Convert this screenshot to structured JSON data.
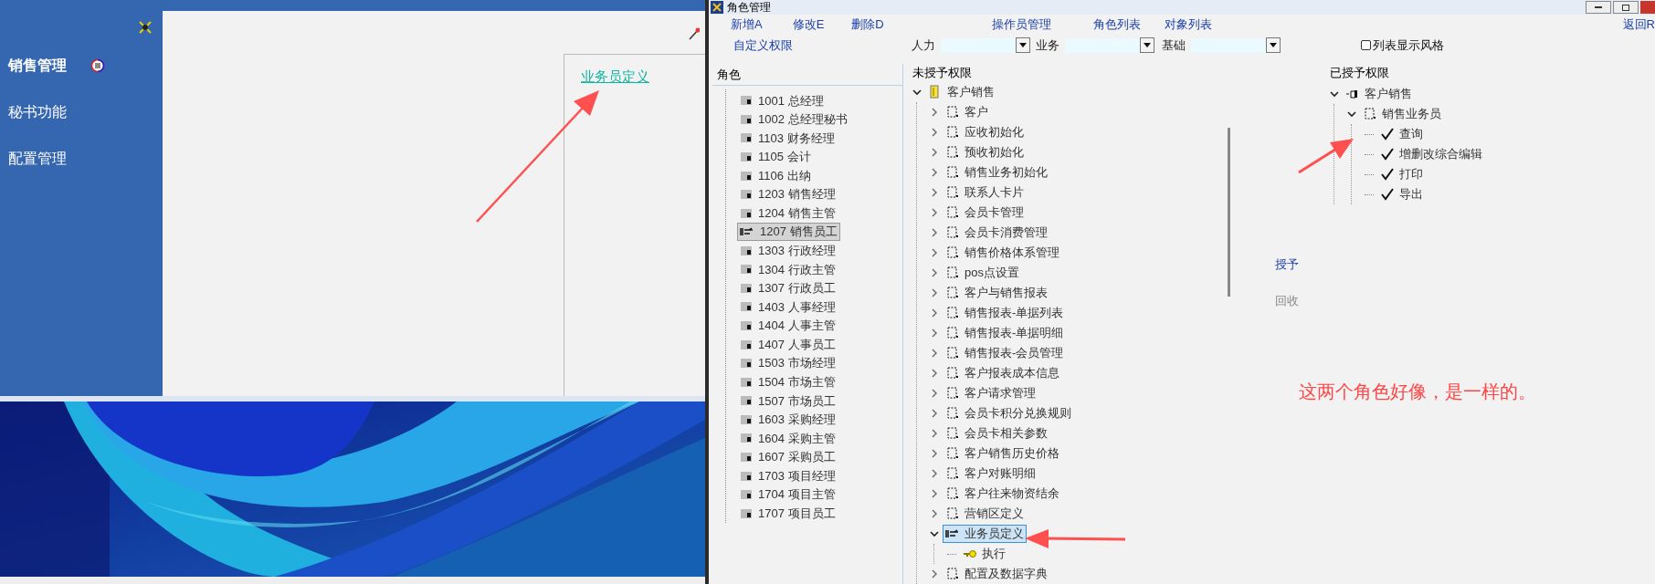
{
  "left_app": {
    "sidebar": {
      "items": [
        {
          "label": "销售管理",
          "selected": true
        },
        {
          "label": "秘书功能",
          "selected": false
        },
        {
          "label": "配置管理",
          "selected": false
        }
      ]
    },
    "panel": {
      "link": "业务员定义"
    }
  },
  "window": {
    "title": "角色管理",
    "toolbar": {
      "edit_buttons": [
        "新增A",
        "修改E",
        "删除D"
      ],
      "list_buttons": [
        "操作员管理",
        "角色列表",
        "对象列表"
      ],
      "return_button": "返回R"
    },
    "filter_bar": {
      "link": "自定义权限",
      "filters": [
        {
          "label": "人力"
        },
        {
          "label": "业务"
        },
        {
          "label": "基础"
        }
      ],
      "checkbox": {
        "label": "列表显示风格",
        "checked": false
      }
    },
    "roles": {
      "header": "角色",
      "items": [
        {
          "label": "1001 总经理",
          "selected": false
        },
        {
          "label": "1002 总经理秘书",
          "selected": false
        },
        {
          "label": "1103 财务经理",
          "selected": false
        },
        {
          "label": "1105 会计",
          "selected": false
        },
        {
          "label": "1106 出纳",
          "selected": false
        },
        {
          "label": "1203 销售经理",
          "selected": false
        },
        {
          "label": "1204 销售主管",
          "selected": false
        },
        {
          "label": "1207 销售员工",
          "selected": true
        },
        {
          "label": "1303 行政经理",
          "selected": false
        },
        {
          "label": "1304 行政主管",
          "selected": false
        },
        {
          "label": "1307 行政员工",
          "selected": false
        },
        {
          "label": "1403 人事经理",
          "selected": false
        },
        {
          "label": "1404 人事主管",
          "selected": false
        },
        {
          "label": "1407 人事员工",
          "selected": false
        },
        {
          "label": "1503 市场经理",
          "selected": false
        },
        {
          "label": "1504 市场主管",
          "selected": false
        },
        {
          "label": "1507 市场员工",
          "selected": false
        },
        {
          "label": "1603 采购经理",
          "selected": false
        },
        {
          "label": "1604 采购主管",
          "selected": false
        },
        {
          "label": "1607 采购员工",
          "selected": false
        },
        {
          "label": "1703 项目经理",
          "selected": false
        },
        {
          "label": "1704 项目主管",
          "selected": false
        },
        {
          "label": "1707 项目员工",
          "selected": false
        }
      ]
    },
    "unassigned": {
      "header": "未授予权限",
      "tree": [
        {
          "label": "客户销售",
          "kind": "folder",
          "expanded": true,
          "selected": false,
          "children": [
            {
              "label": "客户",
              "kind": "node",
              "expanded": false,
              "selected": false
            },
            {
              "label": "应收初始化",
              "kind": "node",
              "expanded": false,
              "selected": false
            },
            {
              "label": "预收初始化",
              "kind": "node",
              "expanded": false,
              "selected": false
            },
            {
              "label": "销售业务初始化",
              "kind": "node",
              "expanded": false,
              "selected": false
            },
            {
              "label": "联系人卡片",
              "kind": "node",
              "expanded": false,
              "selected": false
            },
            {
              "label": "会员卡管理",
              "kind": "node",
              "expanded": false,
              "selected": false
            },
            {
              "label": "会员卡消费管理",
              "kind": "node",
              "expanded": false,
              "selected": false
            },
            {
              "label": "销售价格体系管理",
              "kind": "node",
              "expanded": false,
              "selected": false
            },
            {
              "label": "pos点设置",
              "kind": "node",
              "expanded": false,
              "selected": false
            },
            {
              "label": "客户与销售报表",
              "kind": "node",
              "expanded": false,
              "selected": false
            },
            {
              "label": "销售报表-单据列表",
              "kind": "node",
              "expanded": false,
              "selected": false
            },
            {
              "label": "销售报表-单据明细",
              "kind": "node",
              "expanded": false,
              "selected": false
            },
            {
              "label": "销售报表-会员管理",
              "kind": "node",
              "expanded": false,
              "selected": false
            },
            {
              "label": "客户报表成本信息",
              "kind": "node",
              "expanded": false,
              "selected": false
            },
            {
              "label": "客户请求管理",
              "kind": "node",
              "expanded": false,
              "selected": false
            },
            {
              "label": "会员卡积分兑换规则",
              "kind": "node",
              "expanded": false,
              "selected": false
            },
            {
              "label": "会员卡相关参数",
              "kind": "node",
              "expanded": false,
              "selected": false
            },
            {
              "label": "客户销售历史价格",
              "kind": "node",
              "expanded": false,
              "selected": false
            },
            {
              "label": "客户对账明细",
              "kind": "node",
              "expanded": false,
              "selected": false
            },
            {
              "label": "客户往来物资结余",
              "kind": "node",
              "expanded": false,
              "selected": false
            },
            {
              "label": "营销区定义",
              "kind": "node",
              "expanded": false,
              "selected": false
            },
            {
              "label": "业务员定义",
              "kind": "hand",
              "expanded": true,
              "selected": true,
              "children": [
                {
                  "label": "执行",
                  "kind": "key",
                  "selected": false
                }
              ]
            },
            {
              "label": "配置及数据字典",
              "kind": "node",
              "expanded": false,
              "selected": false
            }
          ]
        }
      ]
    },
    "actions": [
      {
        "label": "授予",
        "disabled": false
      },
      {
        "label": "回收",
        "disabled": true
      }
    ],
    "assigned": {
      "header": "已授予权限",
      "tree": [
        {
          "label": "客户销售",
          "kind": "group",
          "expanded": true,
          "children": [
            {
              "label": "销售业务员",
              "kind": "node",
              "expanded": true,
              "children": [
                {
                  "label": "查询",
                  "kind": "check"
                },
                {
                  "label": "增删改综合编辑",
                  "kind": "check"
                },
                {
                  "label": "打印",
                  "kind": "check"
                },
                {
                  "label": "导出",
                  "kind": "check"
                }
              ]
            }
          ]
        }
      ]
    }
  },
  "annotation": {
    "note": "这两个角色好像，是一样的。"
  }
}
